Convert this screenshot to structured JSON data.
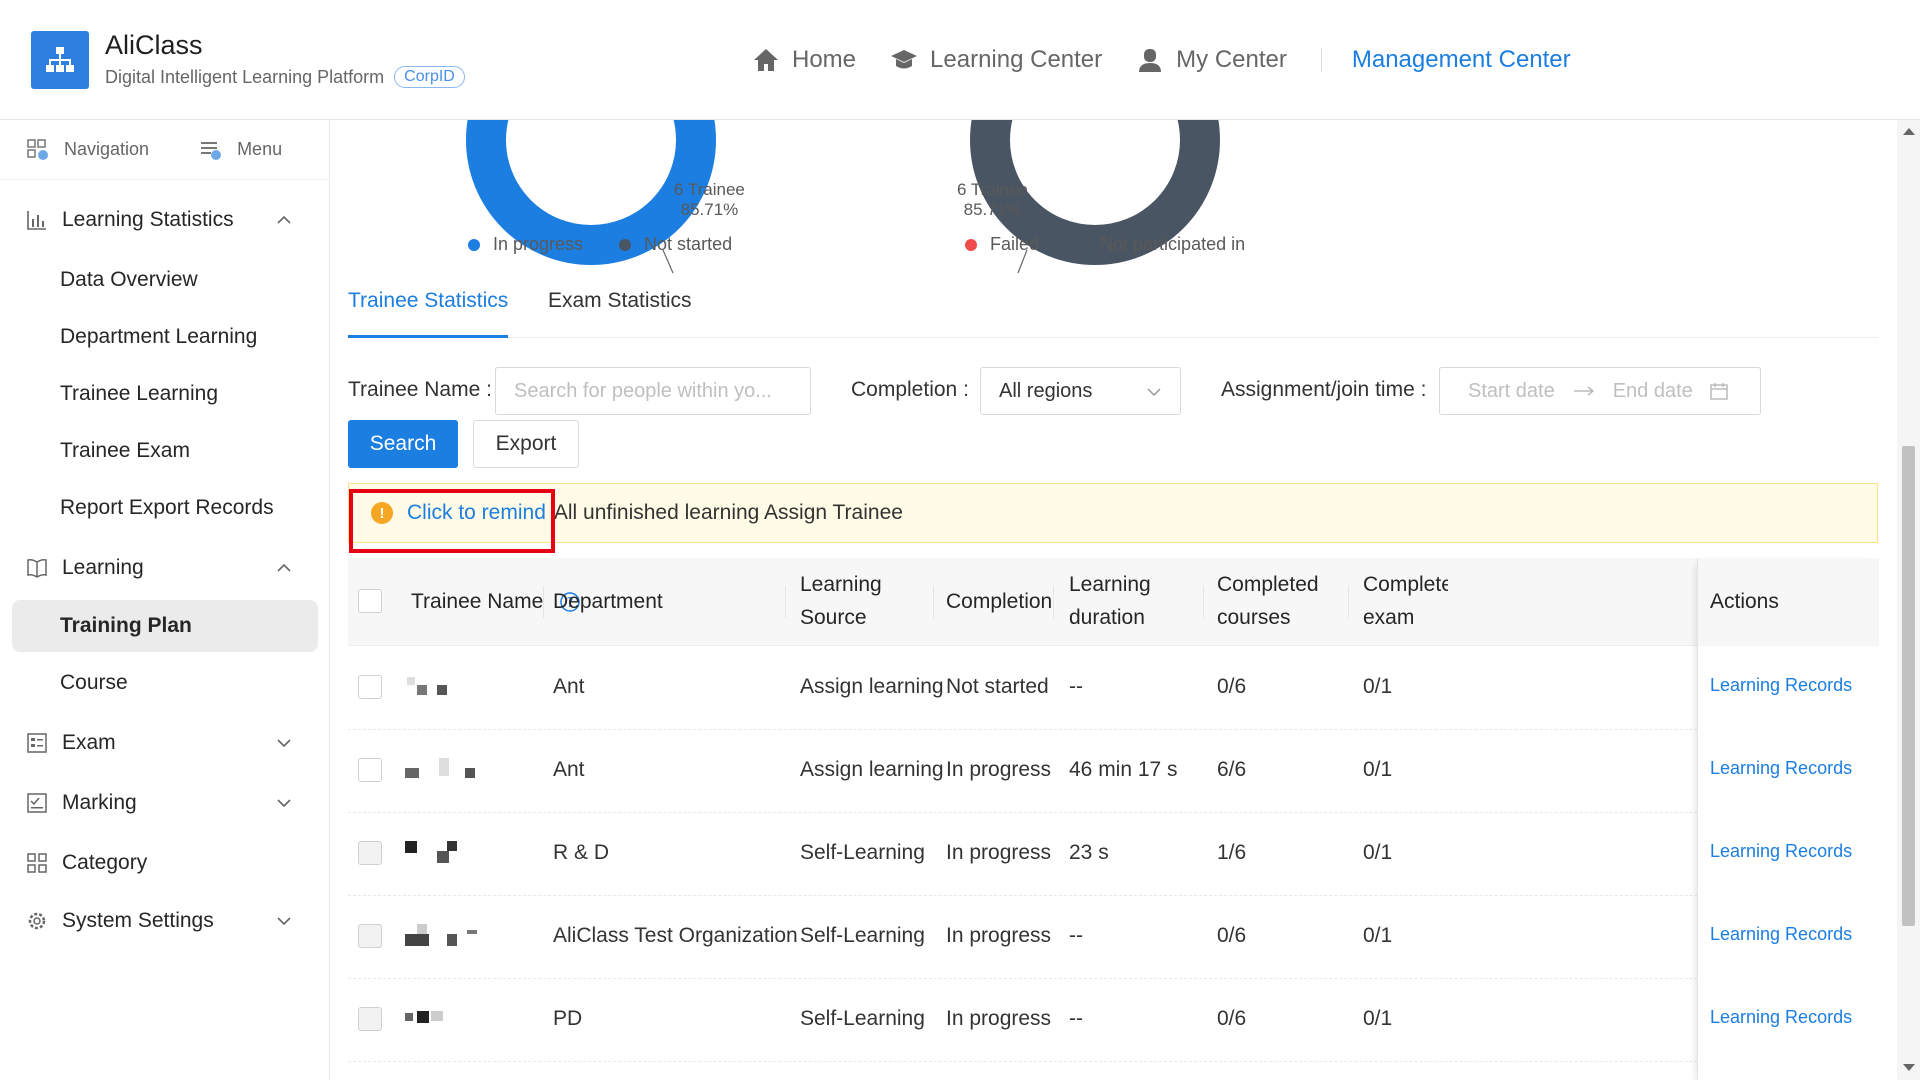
{
  "header": {
    "app_title": "AliClass",
    "app_subtitle": "Digital Intelligent Learning Platform",
    "corp_badge": "CorpID",
    "nav": [
      {
        "label": "Home",
        "icon": "home-icon"
      },
      {
        "label": "Learning Center",
        "icon": "graduation-cap-icon"
      },
      {
        "label": "My Center",
        "icon": "user-icon"
      }
    ],
    "active_nav": "Management Center"
  },
  "sidebar": {
    "top_buttons": [
      {
        "label": "Navigation",
        "icon": "navigation-grid-icon"
      },
      {
        "label": "Menu",
        "icon": "menu-list-icon"
      }
    ],
    "groups": {
      "learning_statistics": "Learning Statistics",
      "learning": "Learning",
      "exam": "Exam",
      "marking": "Marking",
      "category": "Category",
      "system_settings": "System Settings"
    },
    "stats_items": [
      "Data Overview",
      "Department Learning",
      "Trainee Learning",
      "Trainee Exam",
      "Report Export Records"
    ],
    "learning_items": [
      "Training Plan",
      "Course"
    ],
    "active_item": "Training Plan"
  },
  "charts": {
    "left": {
      "label_count": "6 Trainee",
      "label_pct": "85.71%",
      "legend": [
        {
          "label": "In progress",
          "color": "#1b7ee0"
        },
        {
          "label": "Not started",
          "color": "#4a5563"
        }
      ]
    },
    "right": {
      "label_count": "6 Trainee",
      "label_pct": "85.71%",
      "legend": [
        {
          "label": "Failed",
          "color": "#f04b4b"
        },
        {
          "label": "Not participated in",
          "color": "#4a5563"
        }
      ]
    }
  },
  "tabs": [
    "Trainee Statistics",
    "Exam Statistics"
  ],
  "filters": {
    "trainee_name_label": "Trainee Name",
    "trainee_name_placeholder": "Search for people within yo...",
    "completion_label": "Completion",
    "completion_value": "All regions",
    "time_label": "Assignment/join time",
    "start_placeholder": "Start date",
    "end_placeholder": "End date",
    "search_button": "Search",
    "export_button": "Export"
  },
  "alert": {
    "remind_link": "Click to remind",
    "text": "All unfinished learning Assign Trainee"
  },
  "table": {
    "columns": {
      "name": "Trainee Name",
      "department": "Department",
      "source_1": "Learning",
      "source_2": "Source",
      "completion": "Completion",
      "duration_1": "Learning",
      "duration_2": "duration",
      "courses_1": "Completed",
      "courses_2": "courses",
      "exam_1": "Complete",
      "exam_2": "exam",
      "actions": "Actions"
    },
    "rows": [
      {
        "department": "Ant",
        "source": "Assign learning",
        "completion": "Not started",
        "duration": "--",
        "courses": "0/6",
        "exam": "0/1",
        "action": "Learning Records"
      },
      {
        "department": "Ant",
        "source": "Assign learning",
        "completion": "In progress",
        "duration": "46 min 17 s",
        "courses": "6/6",
        "exam": "0/1",
        "action": "Learning Records"
      },
      {
        "department": "R & D",
        "source": "Self-Learning",
        "completion": "In progress",
        "duration": "23 s",
        "courses": "1/6",
        "exam": "0/1",
        "action": "Learning Records"
      },
      {
        "department": "AliClass Test Organization",
        "source": "Self-Learning",
        "completion": "In progress",
        "duration": "--",
        "courses": "0/6",
        "exam": "0/1",
        "action": "Learning Records"
      },
      {
        "department": "PD",
        "source": "Self-Learning",
        "completion": "In progress",
        "duration": "--",
        "courses": "0/6",
        "exam": "0/1",
        "action": "Learning Records"
      }
    ]
  }
}
